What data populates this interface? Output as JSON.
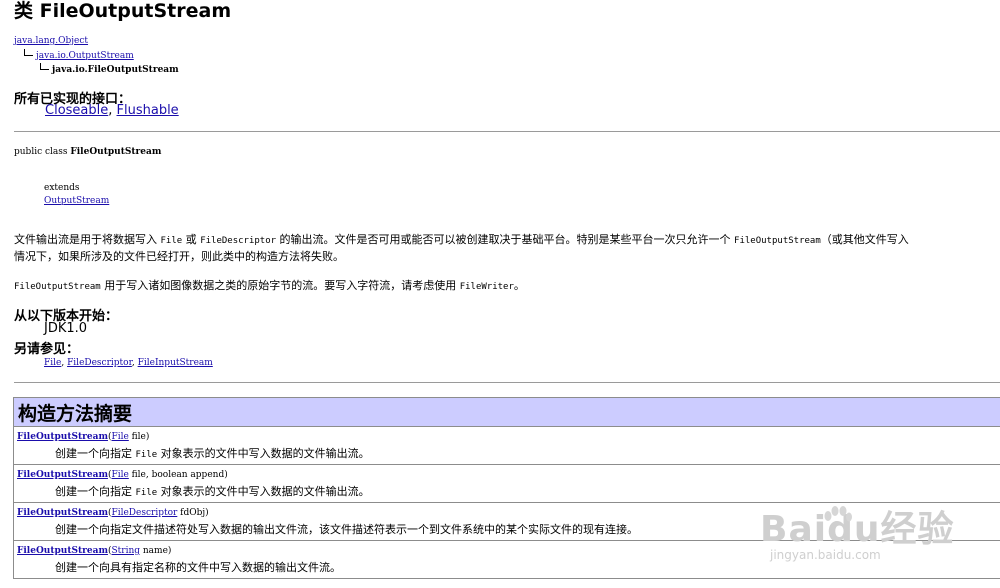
{
  "page": {
    "title": "类 FileOutputStream"
  },
  "hierarchy": {
    "root": "java.lang.Object",
    "parent": "java.io.OutputStream",
    "current": "java.io.FileOutputStream"
  },
  "interfaces": {
    "label": "所有已实现的接口：",
    "items": [
      "Closeable",
      "Flushable"
    ],
    "separator": ", "
  },
  "declaration": {
    "prefix": "public class ",
    "name": "FileOutputStream",
    "extends_kw": "extends",
    "extends_link": "OutputStream"
  },
  "description": {
    "p1": [
      "文件输出流是用于将数据写入 ",
      "File",
      " 或 ",
      "FileDescriptor",
      " 的输出流。文件是否可用或能否可以被创建取决于基础平台。特别是某些平台一次只允许一个 ",
      "FileOutputStream",
      "（或其他文件写入"
    ],
    "p1_line2": "情况下，如果所涉及的文件已经打开，则此类中的构造方法将失败。",
    "p2_code": "FileOutputStream",
    "p2_text": " 用于写入诸如图像数据之类的原始字节的流。要写入字符流，请考虑使用 ",
    "p2_code2": "FileWriter",
    "p2_end": "。"
  },
  "since": {
    "label": "从以下版本开始：",
    "value": "JDK1.0"
  },
  "see_also": {
    "label": "另请参见：",
    "links": [
      "File",
      "FileDescriptor",
      "FileInputStream"
    ],
    "separator": ", "
  },
  "constructors": {
    "title": "构造方法摘要",
    "rows": [
      {
        "name": "FileOutputStream",
        "open": "(",
        "param_type": "File",
        "param_rest": " file)",
        "desc_pre": "创建一个向指定 ",
        "desc_code": "File",
        "desc_post": " 对象表示的文件中写入数据的文件输出流。"
      },
      {
        "name": "FileOutputStream",
        "open": "(",
        "param_type": "File",
        "param_rest": " file, boolean append)",
        "desc_pre": "创建一个向指定 ",
        "desc_code": "File",
        "desc_post": " 对象表示的文件中写入数据的文件输出流。"
      },
      {
        "name": "FileOutputStream",
        "open": "(",
        "param_type": "FileDescriptor",
        "param_rest": " fdObj)",
        "desc_pre": "创建一个向指定文件描述符处写入数据的输出文件流，该文件描述符表示一个到文件系统中的某个实际文件的现有连接。",
        "desc_code": "",
        "desc_post": ""
      },
      {
        "name": "FileOutputStream",
        "open": "(",
        "param_type": "String",
        "param_rest": " name)",
        "desc_pre": "创建一个向具有指定名称的文件中写入数据的输出文件流。",
        "desc_code": "",
        "desc_post": ""
      }
    ]
  },
  "watermark": {
    "brand": "Baidu经验",
    "url": "jingyan.baidu.com",
    "color": "#cfcfcf"
  },
  "colors": {
    "link": "#1a0dab",
    "table_header_bg": "#ccccff",
    "separator": "#9a9a9a"
  }
}
